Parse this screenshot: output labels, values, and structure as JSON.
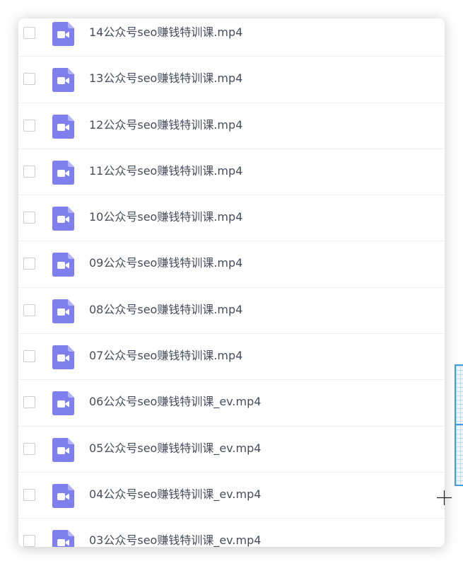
{
  "file_list": {
    "items": [
      {
        "name": "14公众号seo赚钱特训课.mp4",
        "icon": "video-file-icon"
      },
      {
        "name": "13公众号seo赚钱特训课.mp4",
        "icon": "video-file-icon"
      },
      {
        "name": "12公众号seo赚钱特训课.mp4",
        "icon": "video-file-icon"
      },
      {
        "name": "11公众号seo赚钱特训课.mp4",
        "icon": "video-file-icon"
      },
      {
        "name": "10公众号seo赚钱特训课.mp4",
        "icon": "video-file-icon"
      },
      {
        "name": "09公众号seo赚钱特训课.mp4",
        "icon": "video-file-icon"
      },
      {
        "name": "08公众号seo赚钱特训课.mp4",
        "icon": "video-file-icon"
      },
      {
        "name": "07公众号seo赚钱特训课.mp4",
        "icon": "video-file-icon"
      },
      {
        "name": "06公众号seo赚钱特训课_ev.mp4",
        "icon": "video-file-icon"
      },
      {
        "name": "05公众号seo赚钱特训课_ev.mp4",
        "icon": "video-file-icon"
      },
      {
        "name": "04公众号seo赚钱特训课_ev.mp4",
        "icon": "video-file-icon"
      },
      {
        "name": "03公众号seo赚钱特训课_ev.mp4",
        "icon": "video-file-icon"
      }
    ]
  },
  "colors": {
    "icon_accent": "#7f7fee",
    "text": "#454d5c",
    "checkbox_border": "#c9ccd2",
    "side_widget_border": "#3d9fe0"
  }
}
